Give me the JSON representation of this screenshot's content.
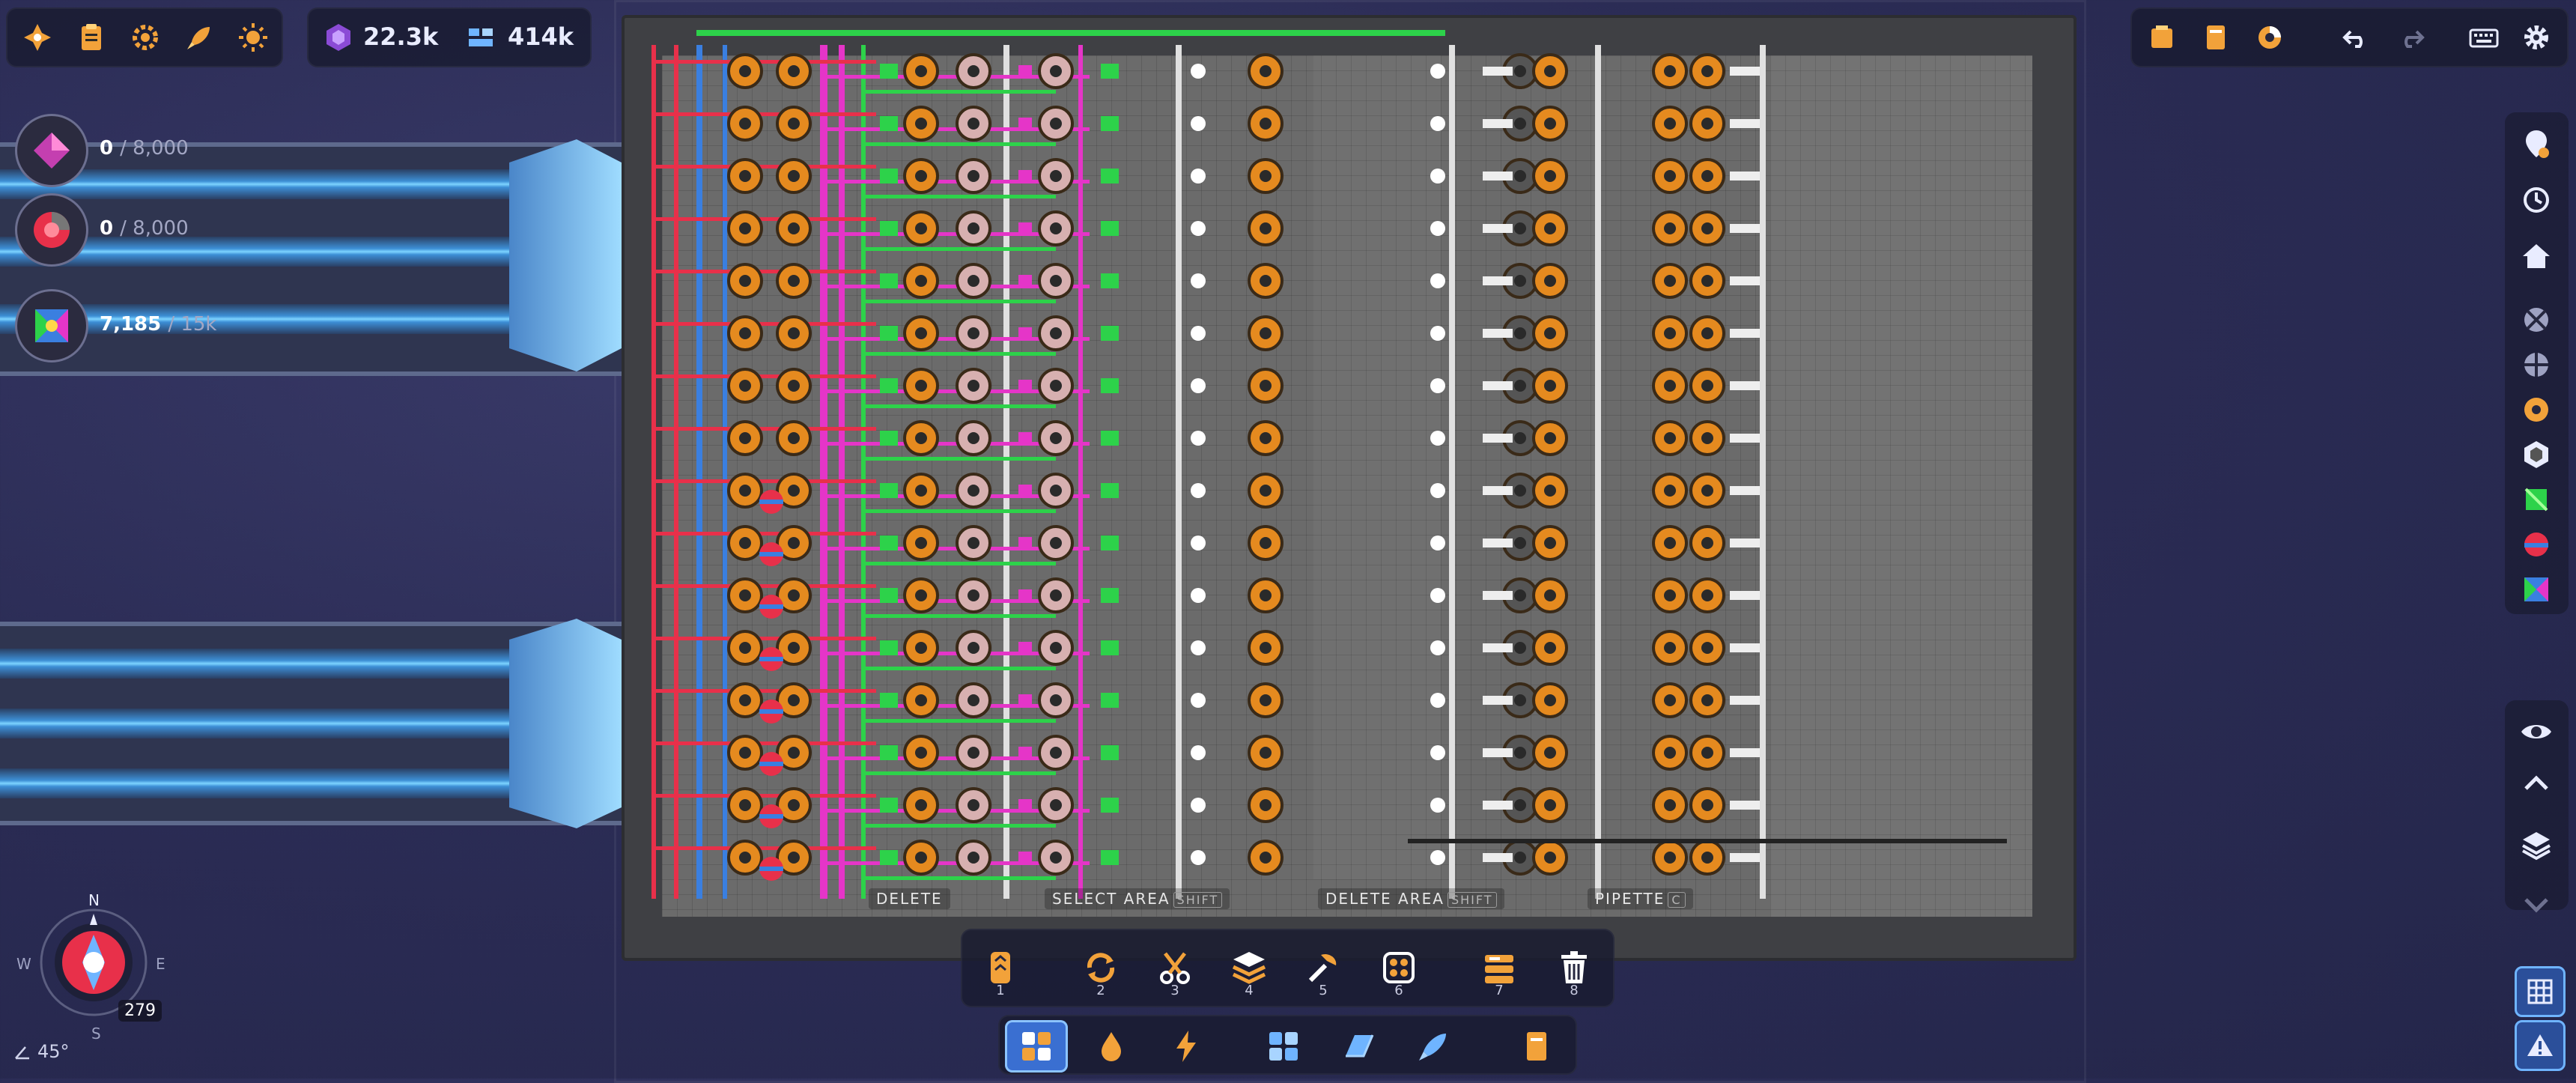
{
  "top_bar": {
    "shapes_count": "22.3k",
    "blueprint_count": "414k"
  },
  "counters": [
    {
      "value": "0",
      "max": "/ 8,000"
    },
    {
      "value": "0",
      "max": "/ 8,000"
    },
    {
      "value": "7,185",
      "max": "/ 15k"
    }
  ],
  "hints": [
    {
      "label": "DELETE",
      "key": ""
    },
    {
      "label": "SELECT AREA",
      "key": "SHIFT"
    },
    {
      "label": "DELETE AREA",
      "key": "SHIFT"
    },
    {
      "label": "PIPETTE",
      "key": "C"
    }
  ],
  "toolbar": {
    "slots": [
      {
        "num": "1",
        "icon": "belt-icon"
      },
      {
        "num": "2",
        "icon": "rotate-icon"
      },
      {
        "num": "3",
        "icon": "cutter-icon"
      },
      {
        "num": "4",
        "icon": "stacker-icon"
      },
      {
        "num": "5",
        "icon": "painter-icon"
      },
      {
        "num": "6",
        "icon": "pin-pusher-icon"
      },
      {
        "num": "7",
        "icon": "storage-icon"
      },
      {
        "num": "8",
        "icon": "trash-icon"
      }
    ],
    "categories": [
      "buildings-icon",
      "fluids-icon",
      "power-icon",
      "blueprints-icon",
      "wires-icon",
      "trains-icon",
      "research-book-icon"
    ]
  },
  "compass": {
    "north": "N",
    "east": "E",
    "south": "S",
    "west": "W",
    "level": "279",
    "angle": "45°"
  },
  "colors": {
    "accent": "#6fb4ff",
    "belt": "#3d8fd6",
    "pipe_magenta": "#e535c8",
    "pipe_green": "#2dd24a",
    "pipe_red": "#e8304a",
    "pipe_blue": "#3a7fe0",
    "machine_orange": "#e58a1f"
  }
}
